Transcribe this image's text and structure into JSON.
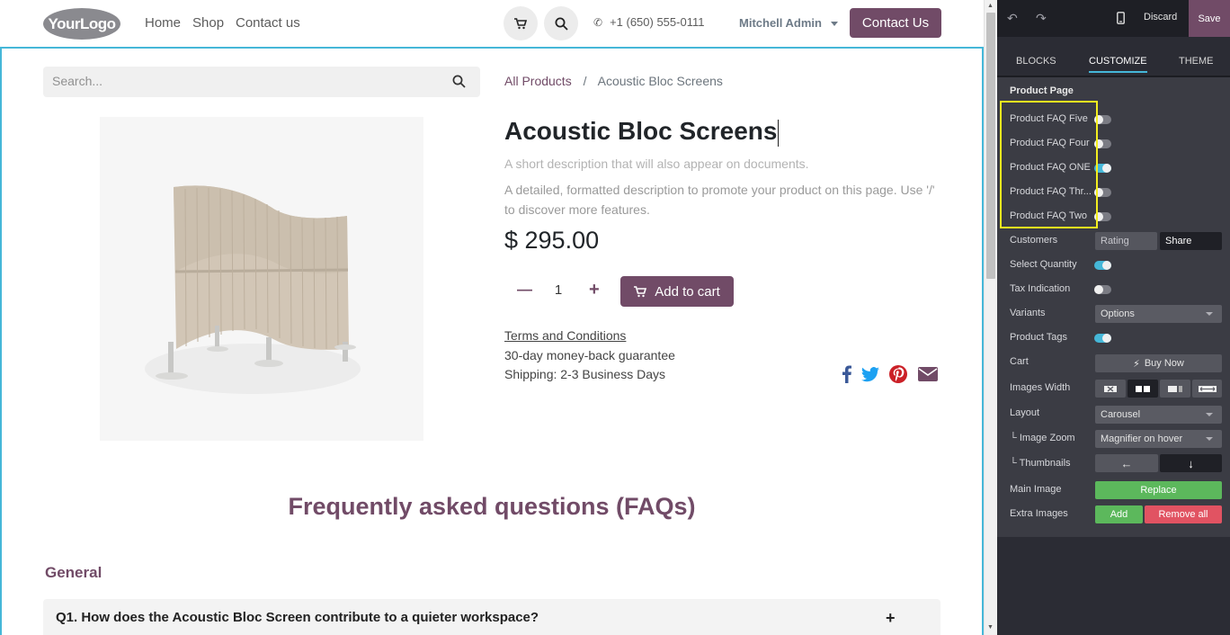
{
  "header": {
    "logo_text": "YourLogo",
    "nav": [
      "Home",
      "Shop",
      "Contact us"
    ],
    "phone": "+1 (650) 555-0111",
    "user": "Mitchell Admin",
    "cta": "Contact Us"
  },
  "search": {
    "placeholder": "Search..."
  },
  "breadcrumb": {
    "all_products": "All Products",
    "separator": "/",
    "current": "Acoustic Bloc Screens"
  },
  "product": {
    "title": "Acoustic Bloc Screens",
    "short_desc": "A short description that will also appear on documents.",
    "long_desc": "A detailed, formatted description to promote your product on this page. Use '/' to discover more features.",
    "price": "$ 295.00",
    "quantity": "1",
    "add_to_cart": "Add to cart",
    "terms": "Terms and Conditions",
    "guarantee": "30-day money-back guarantee",
    "shipping": "Shipping: 2-3 Business Days"
  },
  "share_icons": [
    "facebook-icon",
    "twitter-icon",
    "pinterest-icon",
    "envelope-icon"
  ],
  "faq": {
    "heading": "Frequently asked questions (FAQs)",
    "section": "General",
    "q1": "Q1. How does the Acoustic Bloc Screen contribute to a quieter workspace?"
  },
  "panel": {
    "discard": "Discard",
    "save": "Save",
    "tabs": [
      "BLOCKS",
      "CUSTOMIZE",
      "THEME"
    ],
    "active_tab": "CUSTOMIZE",
    "section_title": "Product Page",
    "faq_toggles": [
      {
        "label": "Product FAQ Five",
        "on": false
      },
      {
        "label": "Product FAQ Four",
        "on": false
      },
      {
        "label": "Product FAQ ONE",
        "on": true
      },
      {
        "label": "Product FAQ Thr...",
        "on": false
      },
      {
        "label": "Product FAQ Two",
        "on": false
      }
    ],
    "customers_label": "Customers",
    "customers_opts": [
      "Rating",
      "Share"
    ],
    "select_quantity": "Select Quantity",
    "tax_indication": "Tax Indication",
    "variants_label": "Variants",
    "variants_value": "Options",
    "product_tags": "Product Tags",
    "cart_label": "Cart",
    "buy_now": "Buy Now",
    "images_width": "Images Width",
    "layout_label": "Layout",
    "layout_value": "Carousel",
    "image_zoom": "└ Image Zoom",
    "image_zoom_value": "Magnifier on hover",
    "thumbnails": "└ Thumbnails",
    "main_image": "Main Image",
    "replace": "Replace",
    "extra_images": "Extra Images",
    "add": "Add",
    "remove_all": "Remove all"
  },
  "colors": {
    "brand": "#714b67",
    "accent": "#45b7d8",
    "highlight": "#f3ee1f",
    "success": "#5cb85c",
    "danger": "#e15362"
  }
}
